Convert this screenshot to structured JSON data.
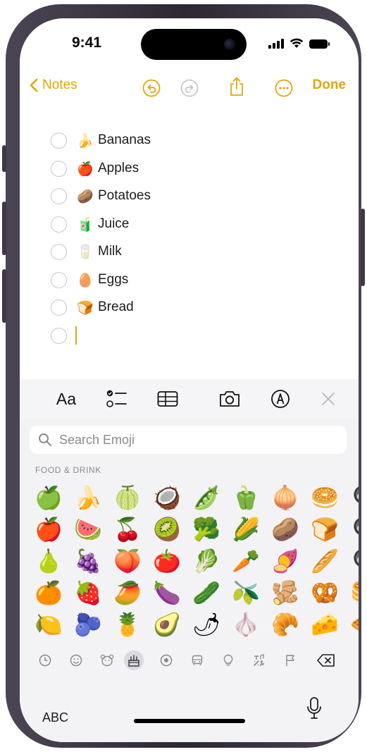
{
  "status_bar": {
    "time": "9:41"
  },
  "toolbar": {
    "back_label": "Notes",
    "done_label": "Done",
    "accent_color": "#e5a50a",
    "icons": [
      "undo-icon",
      "redo-icon",
      "share-icon",
      "more-icon"
    ]
  },
  "checklist": [
    {
      "emoji": "🍌",
      "label": "Bananas"
    },
    {
      "emoji": "🍎",
      "label": "Apples"
    },
    {
      "emoji": "🥔",
      "label": "Potatoes"
    },
    {
      "emoji": "🧃",
      "label": "Juice"
    },
    {
      "emoji": "🥛",
      "label": "Milk"
    },
    {
      "emoji": "🥚",
      "label": "Eggs"
    },
    {
      "emoji": "🍞",
      "label": "Bread"
    }
  ],
  "format_bar": {
    "text_style_label": "Aa",
    "icons": [
      "checklist-icon",
      "table-icon",
      "camera-icon",
      "markup-icon",
      "close-icon"
    ]
  },
  "emoji_keyboard": {
    "search_placeholder": "Search Emoji",
    "category_title": "FOOD & DRINK",
    "rows": [
      [
        "🍏",
        "🍌",
        "🍈",
        "🥥",
        "🫛",
        "🫑",
        "🧅",
        "🥯",
        "🍳"
      ],
      [
        "🍎",
        "🍉",
        "🍒",
        "🥝",
        "🥦",
        "🌽",
        "🥔",
        "🍞",
        "🍳"
      ],
      [
        "🍐",
        "🍇",
        "🍑",
        "🍅",
        "🥬",
        "🥕",
        "🍠",
        "🥖",
        "🍳"
      ],
      [
        "🍊",
        "🍓",
        "🥭",
        "🍆",
        "🥒",
        "🫒",
        "🫚",
        "🥨",
        "🥞"
      ],
      [
        "🍋",
        "🫐",
        "🍍",
        "🥑",
        "🌶",
        "🧄",
        "🥐",
        "🧀",
        "🧇"
      ]
    ],
    "categories": [
      "recent-icon",
      "smileys-icon",
      "animals-icon",
      "food-icon",
      "activity-icon",
      "travel-icon",
      "objects-icon",
      "symbols-icon",
      "flags-icon",
      "delete-icon"
    ],
    "selected_category": "food-icon",
    "abc_label": "ABC"
  }
}
